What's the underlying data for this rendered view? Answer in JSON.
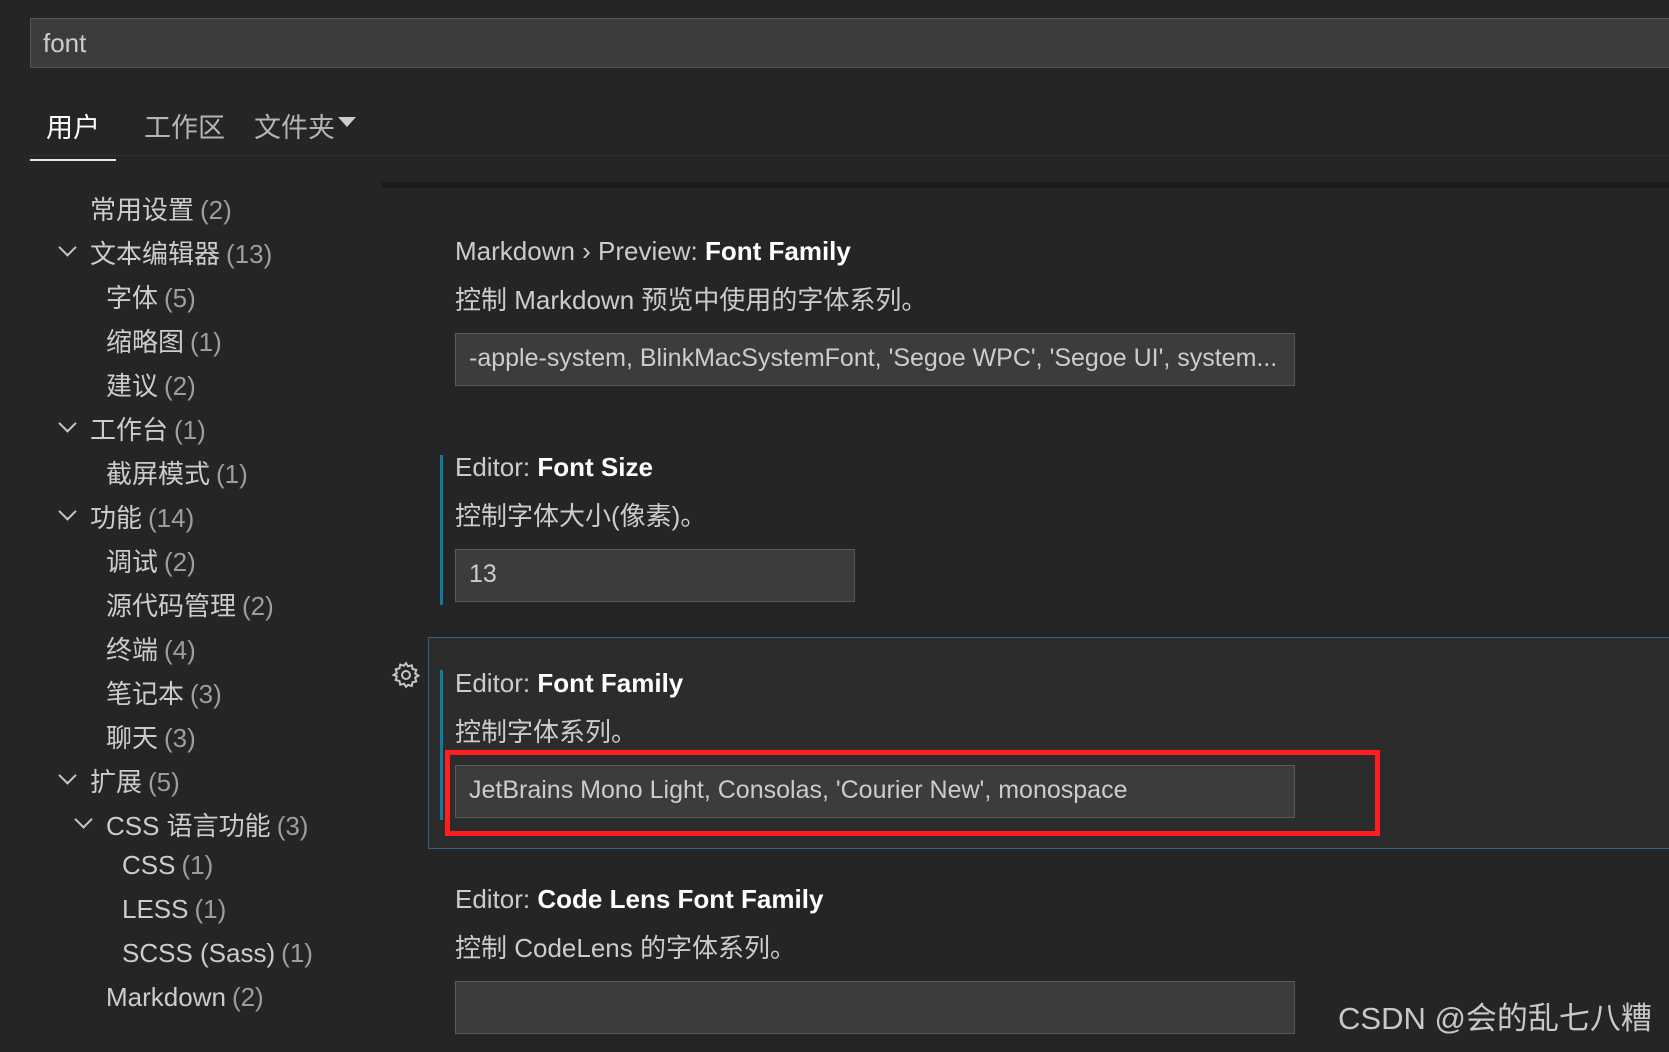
{
  "search": {
    "value": "font"
  },
  "scope_tabs": [
    {
      "label": "用户"
    },
    {
      "label": "工作区"
    },
    {
      "label": "文件夹"
    }
  ],
  "toc": {
    "items": [
      {
        "label": "常用设置",
        "count": "(2)"
      },
      {
        "label": "文本编辑器",
        "count": "(13)"
      },
      {
        "label": "字体",
        "count": "(5)"
      },
      {
        "label": "缩略图",
        "count": "(1)"
      },
      {
        "label": "建议",
        "count": "(2)"
      },
      {
        "label": "工作台",
        "count": "(1)"
      },
      {
        "label": "截屏模式",
        "count": "(1)"
      },
      {
        "label": "功能",
        "count": "(14)"
      },
      {
        "label": "调试",
        "count": "(2)"
      },
      {
        "label": "源代码管理",
        "count": "(2)"
      },
      {
        "label": "终端",
        "count": "(4)"
      },
      {
        "label": "笔记本",
        "count": "(3)"
      },
      {
        "label": "聊天",
        "count": "(3)"
      },
      {
        "label": "扩展",
        "count": "(5)"
      },
      {
        "label": "CSS 语言功能",
        "count": "(3)"
      },
      {
        "label": "CSS",
        "count": "(1)"
      },
      {
        "label": "LESS",
        "count": "(1)"
      },
      {
        "label": "SCSS (Sass)",
        "count": "(1)"
      },
      {
        "label": "Markdown",
        "count": "(2)"
      }
    ]
  },
  "settings": [
    {
      "category": "Markdown › Preview: ",
      "name": "Font Family",
      "description": "控制 Markdown 预览中使用的字体系列。",
      "value": "-apple-system, BlinkMacSystemFont, 'Segoe WPC', 'Segoe UI', system..."
    },
    {
      "category": "Editor: ",
      "name": "Font Size",
      "description": "控制字体大小(像素)。",
      "value": "13"
    },
    {
      "category": "Editor: ",
      "name": "Font Family",
      "description": "控制字体系列。",
      "value": "JetBrains Mono Light, Consolas, 'Courier New', monospace"
    },
    {
      "category": "Editor: ",
      "name": "Code Lens Font Family",
      "description": "控制 CodeLens 的字体系列。",
      "value": ""
    }
  ],
  "watermark": "CSDN @会的乱七八糟",
  "colors": {
    "background": "#252526",
    "input_background": "#3c3c3c",
    "modified_indicator": "#0c7d9d",
    "focus_border": "#3b5d83",
    "highlight_box": "#ff1f1f"
  },
  "icons": {
    "setting_gear": "gear-icon",
    "scope_dropdown": "chevron-down-icon",
    "tree_twistie": "chevron-down-icon"
  }
}
